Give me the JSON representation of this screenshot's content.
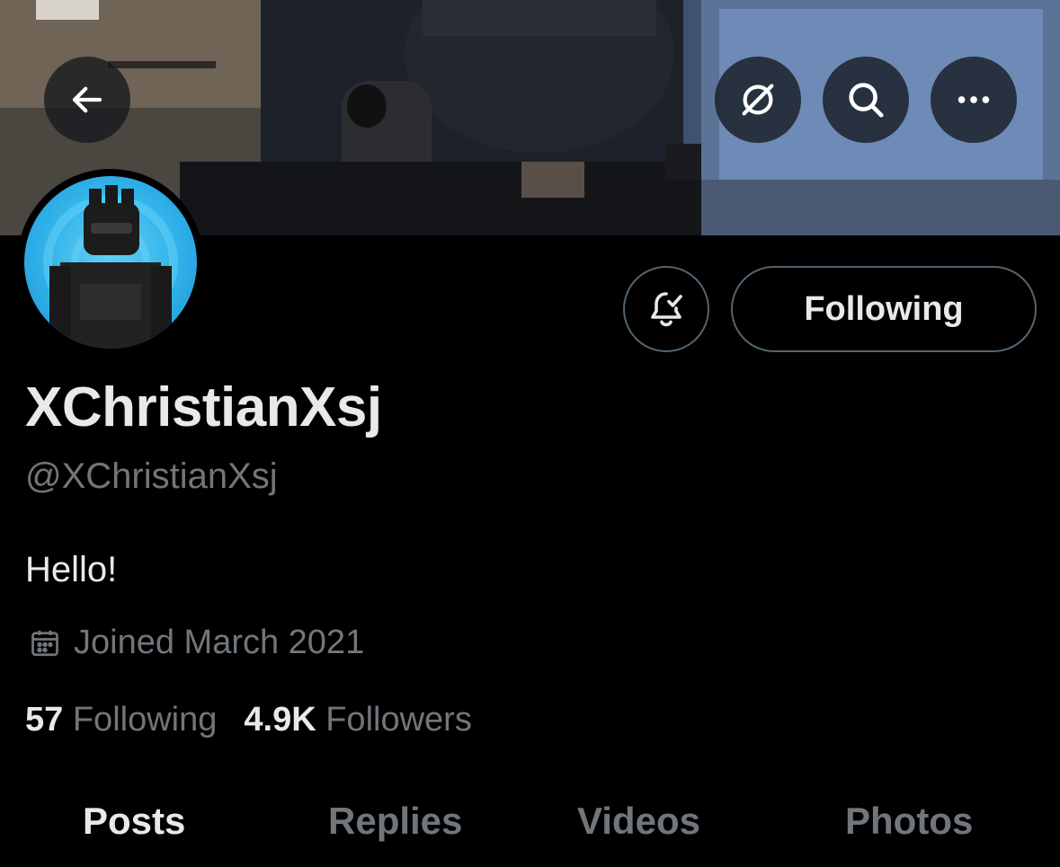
{
  "header": {
    "back_icon": "arrow-left-icon",
    "grok_icon": "grok-icon",
    "search_icon": "search-icon",
    "more_icon": "more-horizontal-icon"
  },
  "actions": {
    "notify_icon": "bell-check-icon",
    "follow_label": "Following"
  },
  "profile": {
    "display_name": "XChristianXsj",
    "handle": "@XChristianXsj",
    "bio": "Hello!",
    "joined_icon": "calendar-icon",
    "joined": "Joined March 2021"
  },
  "stats": {
    "following_count": "57",
    "following_label": "Following",
    "followers_count": "4.9K",
    "followers_label": "Followers"
  },
  "tabs": [
    {
      "label": "Posts",
      "active": true
    },
    {
      "label": "Replies",
      "active": false
    },
    {
      "label": "Videos",
      "active": false
    },
    {
      "label": "Photos",
      "active": false
    }
  ],
  "colors": {
    "background": "#000000",
    "primary_text": "#e7e9ea",
    "secondary_text": "#71767b",
    "border": "#536471"
  }
}
